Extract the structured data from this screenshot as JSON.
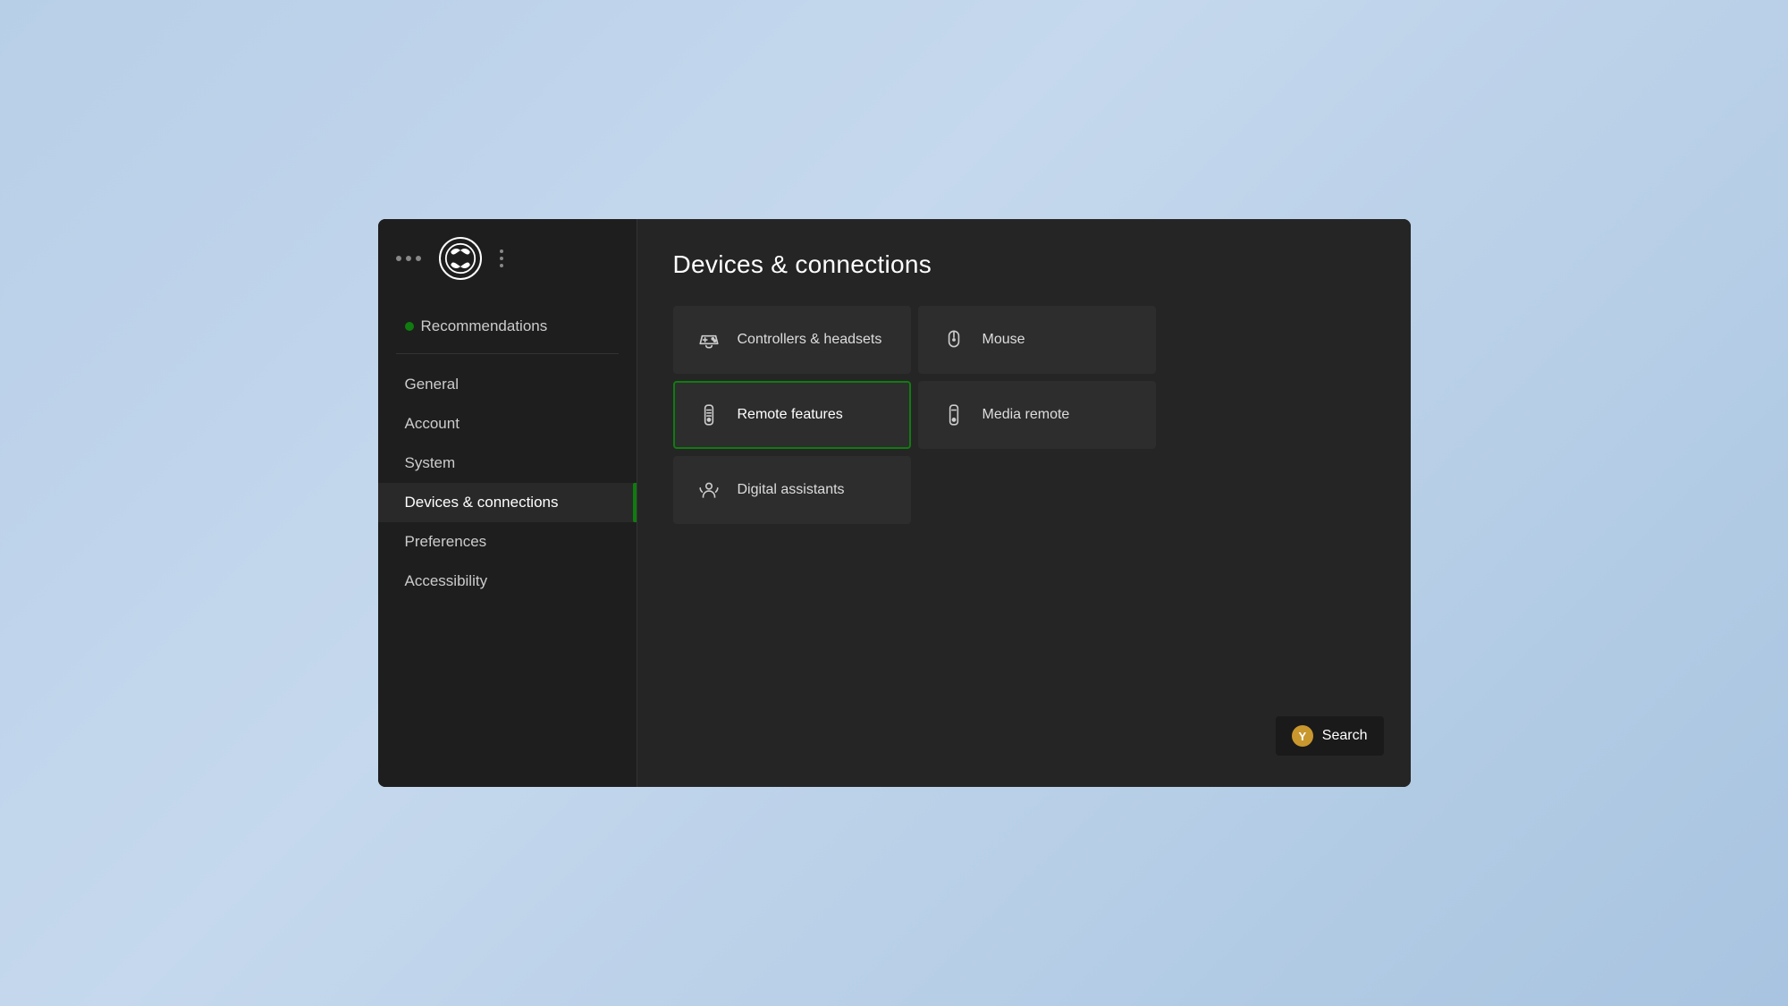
{
  "window": {
    "title": "Devices & connections"
  },
  "sidebar": {
    "recommendations_label": "Recommendations",
    "items": [
      {
        "id": "general",
        "label": "General",
        "active": false
      },
      {
        "id": "account",
        "label": "Account",
        "active": false
      },
      {
        "id": "system",
        "label": "System",
        "active": false
      },
      {
        "id": "devices",
        "label": "Devices & connections",
        "active": true
      },
      {
        "id": "preferences",
        "label": "Preferences",
        "active": false
      },
      {
        "id": "accessibility",
        "label": "Accessibility",
        "active": false
      }
    ]
  },
  "main": {
    "title": "Devices & connections",
    "grid_items": [
      {
        "id": "controllers",
        "label": "Controllers & headsets",
        "icon": "controller-icon",
        "selected": false
      },
      {
        "id": "mouse",
        "label": "Mouse",
        "icon": "mouse-icon",
        "selected": false
      },
      {
        "id": "remote_features",
        "label": "Remote features",
        "icon": "remote-icon",
        "selected": true
      },
      {
        "id": "media_remote",
        "label": "Media remote",
        "icon": "media-remote-icon",
        "selected": false
      },
      {
        "id": "digital_assistants",
        "label": "Digital assistants",
        "icon": "assistant-icon",
        "selected": false
      }
    ]
  },
  "search": {
    "label": "Search",
    "button_icon": "Y"
  }
}
